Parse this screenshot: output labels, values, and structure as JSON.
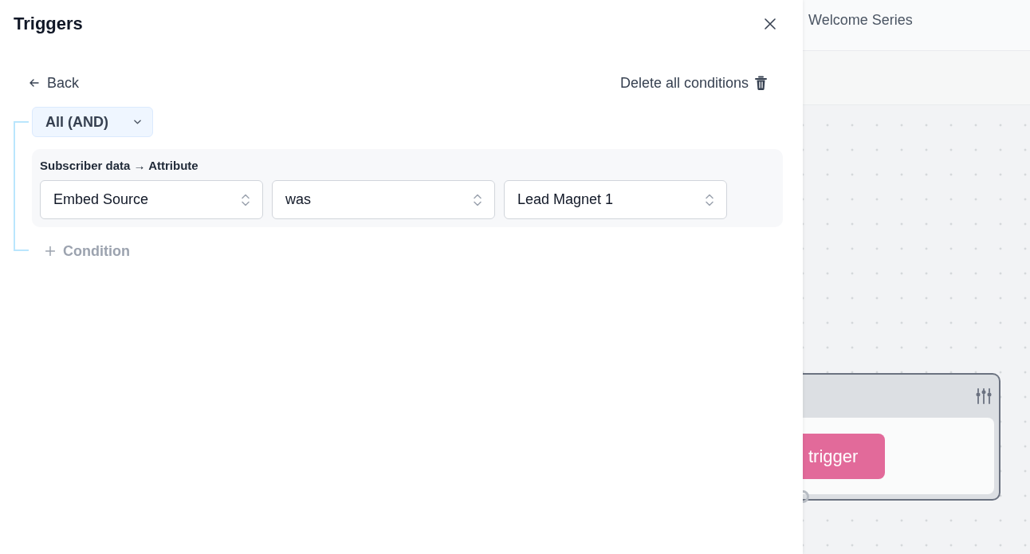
{
  "panel": {
    "title": "Triggers",
    "back": {
      "label": "Back"
    },
    "delete_all": {
      "label": "Delete all conditions"
    },
    "group": {
      "operator": "All (AND)",
      "conditions": [
        {
          "source": "Subscriber data → Attribute",
          "fields": [
            {
              "value": "Embed Source"
            },
            {
              "value": "was"
            },
            {
              "value": "Lead Magnet 1"
            }
          ]
        }
      ],
      "add_condition": {
        "label": "Condition"
      }
    }
  },
  "workflow": {
    "breadcrumb": "Welcome Series",
    "node": {
      "button": "trigger"
    }
  }
}
